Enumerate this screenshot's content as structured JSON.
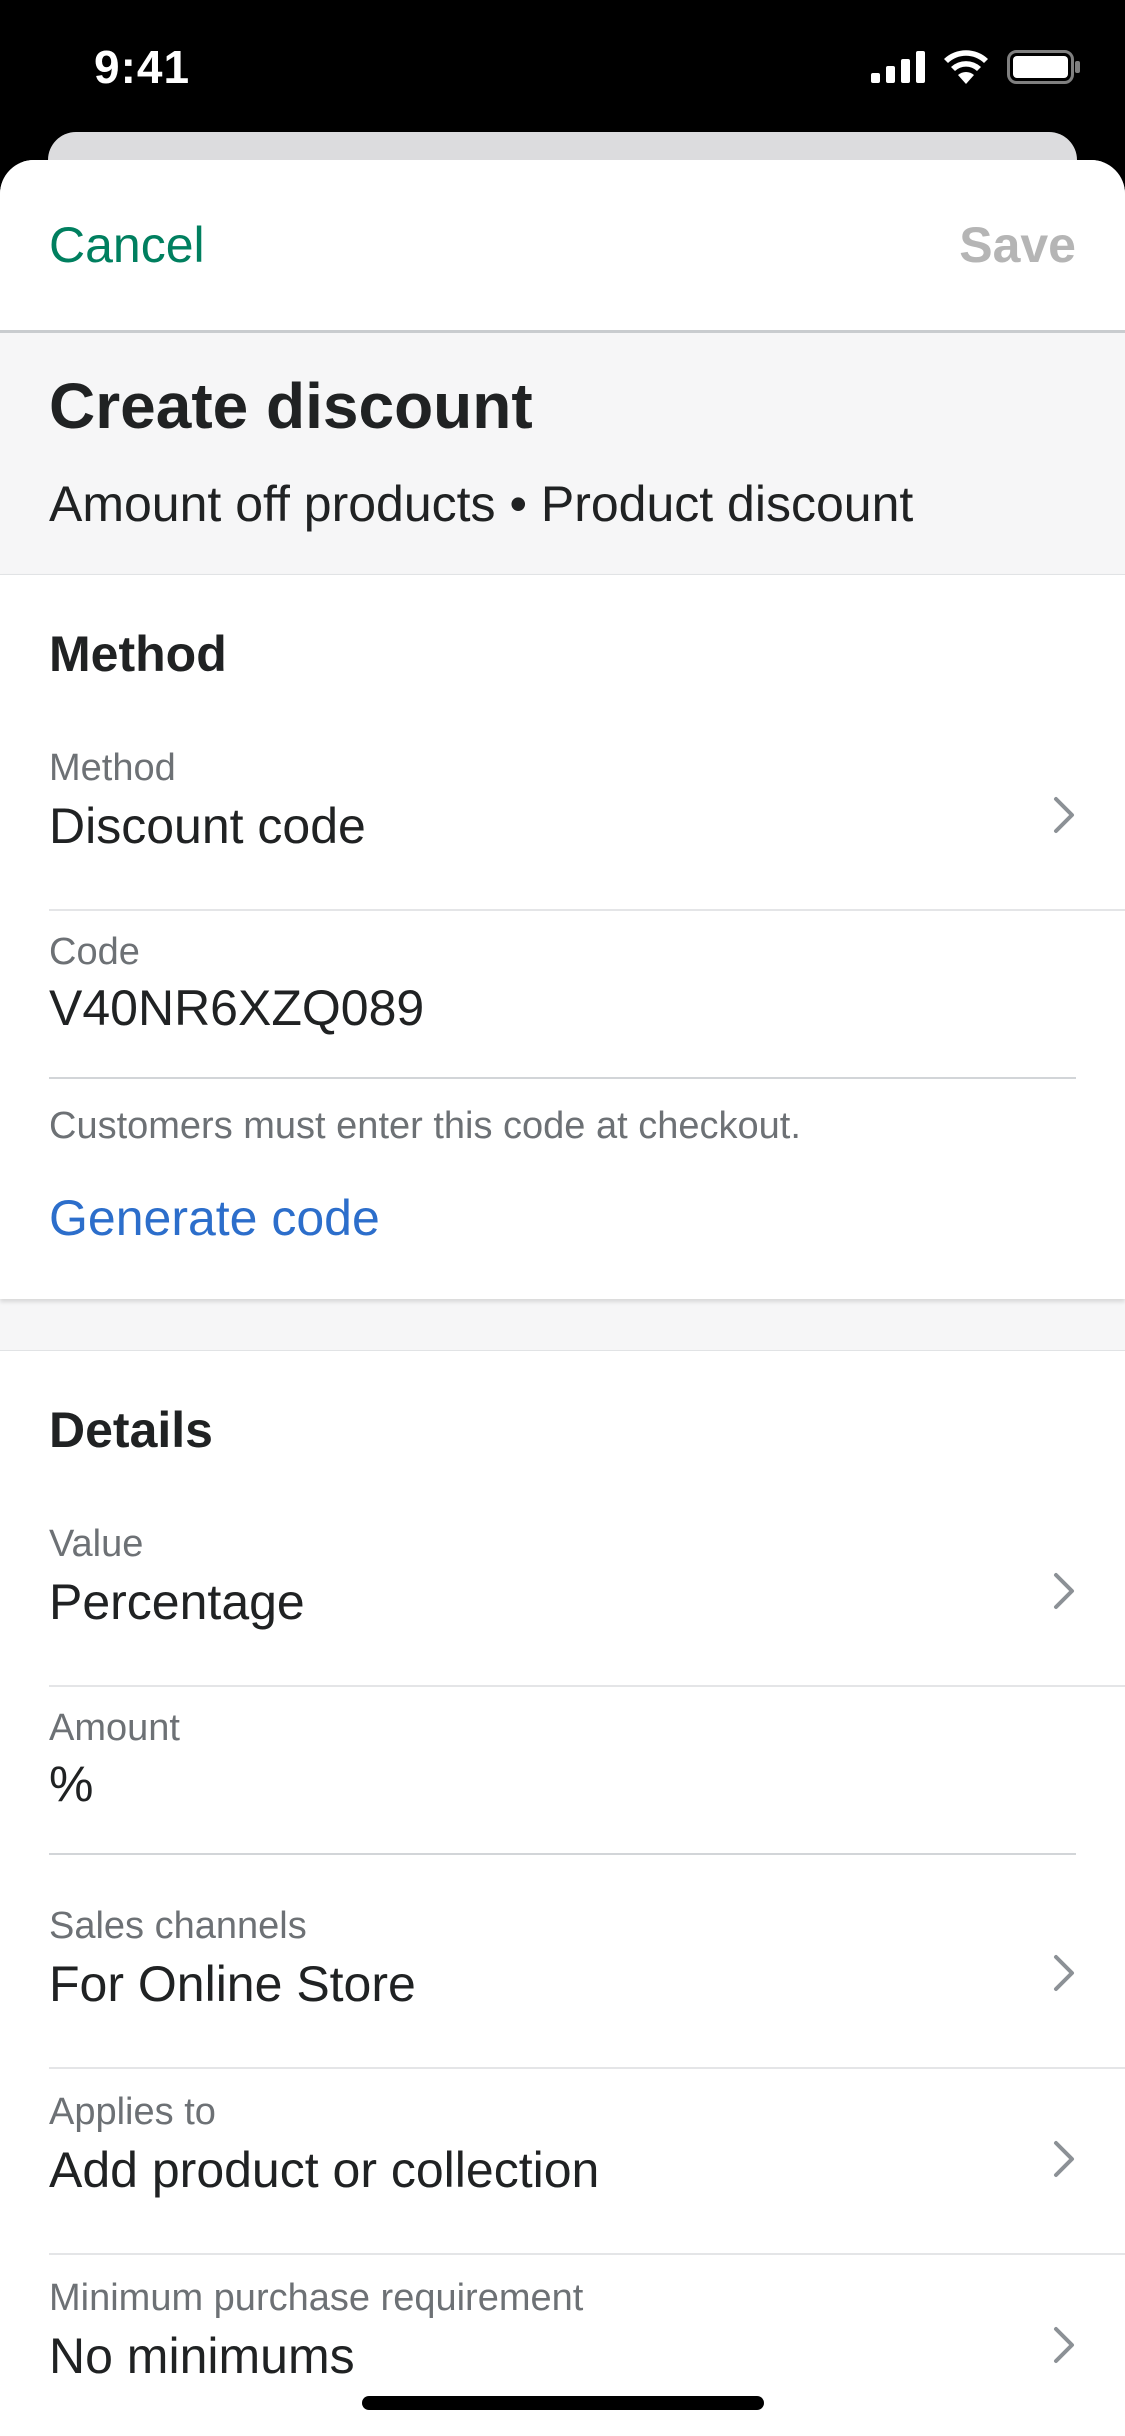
{
  "status_bar": {
    "time": "9:41"
  },
  "nav": {
    "cancel_label": "Cancel",
    "save_label": "Save"
  },
  "header": {
    "title": "Create discount",
    "subtitle": "Amount off products • Product discount"
  },
  "method_section": {
    "title": "Method",
    "method_row": {
      "label": "Method",
      "value": "Discount code"
    },
    "code_row": {
      "label": "Code",
      "value": "V40NR6XZQ089"
    },
    "helper_text": "Customers must enter this code at checkout.",
    "generate_label": "Generate code"
  },
  "details_section": {
    "title": "Details",
    "rows": [
      {
        "label": "Value",
        "value": "Percentage"
      },
      {
        "label": "Amount",
        "value": "%"
      },
      {
        "label": "Sales channels",
        "value": "For Online Store"
      },
      {
        "label": "Applies to",
        "value": "Add product or collection"
      },
      {
        "label": "Minimum purchase requirement",
        "value": "No minimums"
      }
    ]
  },
  "colors": {
    "accent_green": "#007f5f",
    "link_blue": "#2c6ecb",
    "disabled_gray": "#b5b5b5",
    "text_primary": "#202223",
    "text_secondary": "#6d7175"
  },
  "icons": [
    "signal-icon",
    "wifi-icon",
    "battery-icon",
    "chevron-right-icon"
  ]
}
